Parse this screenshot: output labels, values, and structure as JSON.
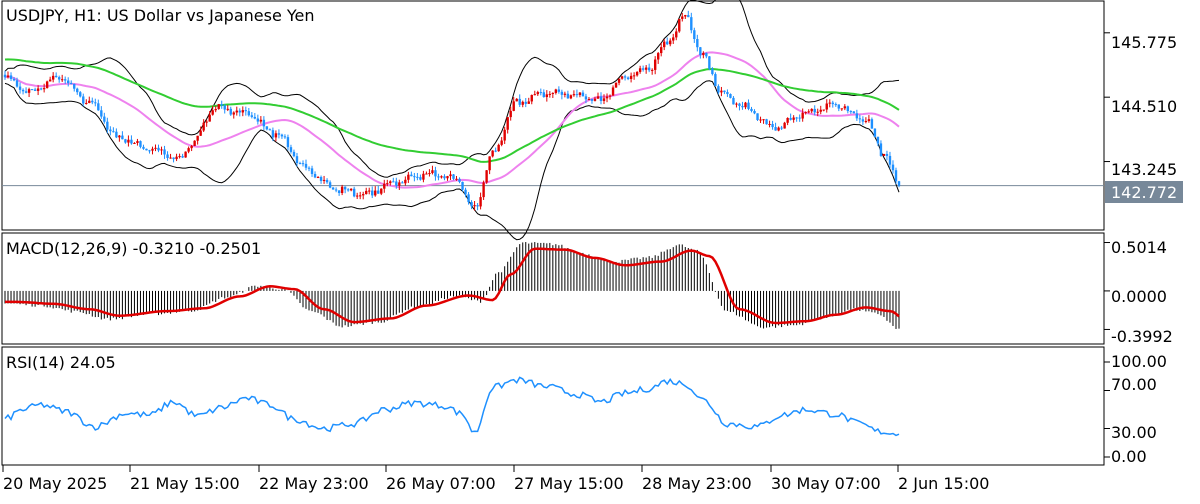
{
  "chart_data": [
    {
      "type": "candlestick",
      "title": "USDJPY, H1:  US Dollar vs Japanese Yen",
      "y_ticks": [
        "145.775",
        "144.510",
        "143.245"
      ],
      "ylim": [
        141.9,
        146.4
      ],
      "last_price": "142.772",
      "last_value": 142.772,
      "x_ticks": [
        "20 May 2025",
        "21 May 15:00",
        "22 May 23:00",
        "26 May 07:00",
        "27 May 15:00",
        "28 May 23:00",
        "30 May 07:00",
        "2 Jun 15:00"
      ],
      "colors": {
        "up": "#e00000",
        "down": "#1e90ff",
        "ma_fast": "#ee82ee",
        "ma_slow": "#32cd32",
        "bands": "#000000",
        "last_price_bg": "#778899"
      },
      "key_points": [
        {
          "x": 0,
          "y": 144.9
        },
        {
          "x": 8,
          "y": 144.6
        },
        {
          "x": 18,
          "y": 144.9
        },
        {
          "x": 28,
          "y": 144.4
        },
        {
          "x": 38,
          "y": 143.7
        },
        {
          "x": 48,
          "y": 143.5
        },
        {
          "x": 58,
          "y": 143.3
        },
        {
          "x": 62,
          "y": 143.6
        },
        {
          "x": 70,
          "y": 144.3
        },
        {
          "x": 80,
          "y": 144.2
        },
        {
          "x": 90,
          "y": 143.8
        },
        {
          "x": 100,
          "y": 143.1
        },
        {
          "x": 110,
          "y": 142.7
        },
        {
          "x": 120,
          "y": 142.6
        },
        {
          "x": 130,
          "y": 142.85
        },
        {
          "x": 140,
          "y": 143.0
        },
        {
          "x": 150,
          "y": 142.9
        },
        {
          "x": 156,
          "y": 142.3
        },
        {
          "x": 162,
          "y": 143.4
        },
        {
          "x": 170,
          "y": 144.4
        },
        {
          "x": 180,
          "y": 144.6
        },
        {
          "x": 190,
          "y": 144.55
        },
        {
          "x": 198,
          "y": 144.45
        },
        {
          "x": 206,
          "y": 144.9
        },
        {
          "x": 214,
          "y": 145.1
        },
        {
          "x": 220,
          "y": 145.6
        },
        {
          "x": 226,
          "y": 146.1
        },
        {
          "x": 232,
          "y": 145.3
        },
        {
          "x": 238,
          "y": 144.6
        },
        {
          "x": 246,
          "y": 144.3
        },
        {
          "x": 256,
          "y": 143.9
        },
        {
          "x": 266,
          "y": 144.2
        },
        {
          "x": 276,
          "y": 144.35
        },
        {
          "x": 286,
          "y": 144.05
        },
        {
          "x": 292,
          "y": 143.4
        },
        {
          "x": 297,
          "y": 142.77
        }
      ]
    },
    {
      "type": "macd",
      "label": "MACD(12,26,9) -0.3210 -0.2501",
      "y_ticks": [
        "0.5014",
        "0.0000",
        "-0.3992"
      ],
      "ylim": [
        -0.55,
        0.6
      ],
      "ticks_values": [
        0.5014,
        0.0,
        -0.3992
      ],
      "colors": {
        "histogram": "#000000",
        "signal": "#e00000"
      },
      "key_points": [
        {
          "x": 0,
          "y": -0.12
        },
        {
          "x": 12,
          "y": -0.14
        },
        {
          "x": 24,
          "y": -0.2
        },
        {
          "x": 34,
          "y": -0.27
        },
        {
          "x": 50,
          "y": -0.22
        },
        {
          "x": 62,
          "y": -0.19
        },
        {
          "x": 74,
          "y": -0.06
        },
        {
          "x": 84,
          "y": 0.05
        },
        {
          "x": 92,
          "y": 0.02
        },
        {
          "x": 102,
          "y": -0.2
        },
        {
          "x": 112,
          "y": -0.34
        },
        {
          "x": 124,
          "y": -0.3
        },
        {
          "x": 136,
          "y": -0.16
        },
        {
          "x": 150,
          "y": -0.05
        },
        {
          "x": 158,
          "y": -0.1
        },
        {
          "x": 164,
          "y": 0.18
        },
        {
          "x": 172,
          "y": 0.46
        },
        {
          "x": 182,
          "y": 0.45
        },
        {
          "x": 192,
          "y": 0.36
        },
        {
          "x": 202,
          "y": 0.28
        },
        {
          "x": 214,
          "y": 0.32
        },
        {
          "x": 224,
          "y": 0.44
        },
        {
          "x": 230,
          "y": 0.38
        },
        {
          "x": 240,
          "y": -0.2
        },
        {
          "x": 252,
          "y": -0.35
        },
        {
          "x": 262,
          "y": -0.33
        },
        {
          "x": 272,
          "y": -0.26
        },
        {
          "x": 282,
          "y": -0.18
        },
        {
          "x": 290,
          "y": -0.22
        },
        {
          "x": 297,
          "y": -0.37
        }
      ]
    },
    {
      "type": "rsi",
      "label": "RSI(14) 24.05",
      "y_ticks": [
        "100.00",
        "70.00",
        "30.00",
        "0.00"
      ],
      "ylim": [
        0,
        100
      ],
      "ticks_values": [
        100,
        70,
        30,
        0
      ],
      "colors": {
        "line": "#1e90ff"
      },
      "key_points": [
        {
          "x": 0,
          "y": 40
        },
        {
          "x": 6,
          "y": 50
        },
        {
          "x": 12,
          "y": 55
        },
        {
          "x": 20,
          "y": 48
        },
        {
          "x": 30,
          "y": 32
        },
        {
          "x": 40,
          "y": 46
        },
        {
          "x": 48,
          "y": 44
        },
        {
          "x": 56,
          "y": 58
        },
        {
          "x": 64,
          "y": 43
        },
        {
          "x": 72,
          "y": 52
        },
        {
          "x": 80,
          "y": 62
        },
        {
          "x": 88,
          "y": 55
        },
        {
          "x": 96,
          "y": 40
        },
        {
          "x": 106,
          "y": 30
        },
        {
          "x": 116,
          "y": 35
        },
        {
          "x": 126,
          "y": 50
        },
        {
          "x": 136,
          "y": 57
        },
        {
          "x": 146,
          "y": 54
        },
        {
          "x": 152,
          "y": 45
        },
        {
          "x": 156,
          "y": 25
        },
        {
          "x": 162,
          "y": 73
        },
        {
          "x": 170,
          "y": 81
        },
        {
          "x": 180,
          "y": 74
        },
        {
          "x": 190,
          "y": 66
        },
        {
          "x": 198,
          "y": 58
        },
        {
          "x": 206,
          "y": 67
        },
        {
          "x": 214,
          "y": 72
        },
        {
          "x": 220,
          "y": 80
        },
        {
          "x": 226,
          "y": 77
        },
        {
          "x": 232,
          "y": 60
        },
        {
          "x": 240,
          "y": 35
        },
        {
          "x": 250,
          "y": 32
        },
        {
          "x": 258,
          "y": 44
        },
        {
          "x": 266,
          "y": 50
        },
        {
          "x": 276,
          "y": 45
        },
        {
          "x": 284,
          "y": 35
        },
        {
          "x": 290,
          "y": 27
        },
        {
          "x": 297,
          "y": 24
        }
      ]
    }
  ]
}
